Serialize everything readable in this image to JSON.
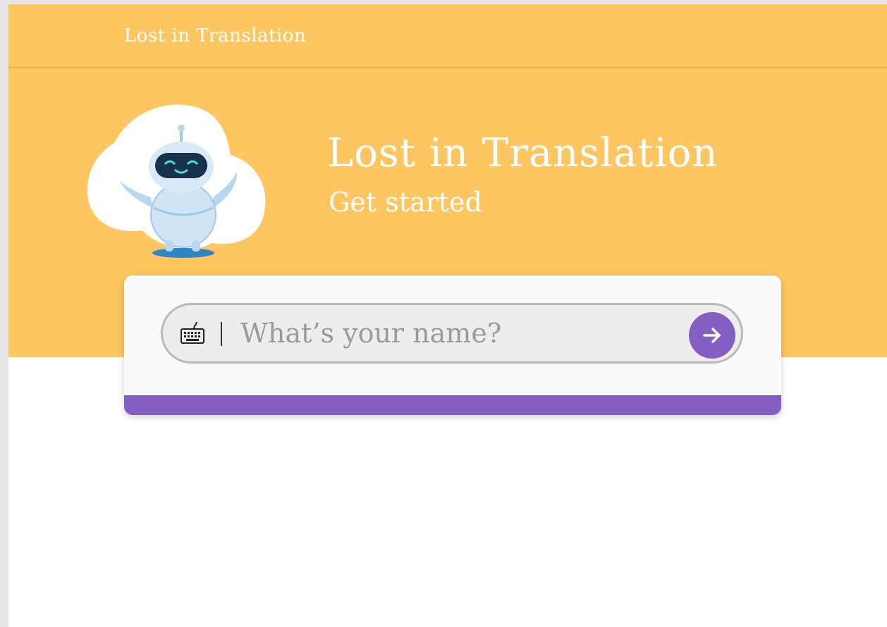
{
  "navbar": {
    "brand": "Lost in Translation"
  },
  "hero": {
    "title": "Lost in Translation",
    "subtitle": "Get started",
    "mascot_icon": "robot-mascot-icon"
  },
  "login": {
    "input_placeholder": "What’s your name?",
    "input_value": "",
    "keyboard_icon": "keyboard-icon",
    "submit_icon": "arrow-right-icon"
  },
  "colors": {
    "primary_yellow": "#fdc661",
    "accent_purple": "#845ec2",
    "text_white": "#ffffff"
  }
}
